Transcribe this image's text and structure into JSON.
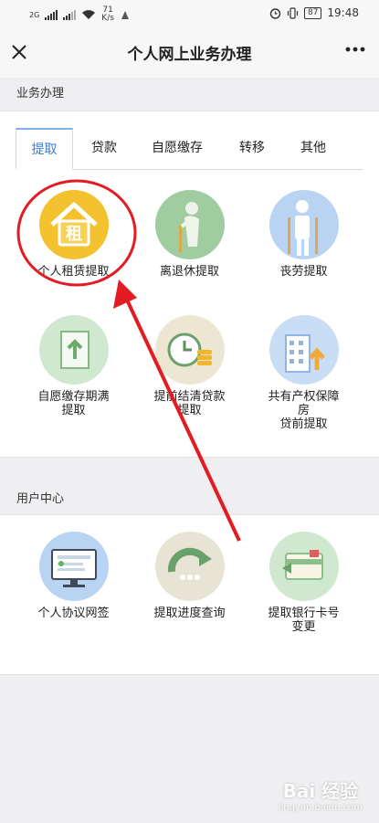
{
  "status_bar": {
    "network": "2G",
    "net_speed_value": "71",
    "net_speed_unit": "K/s",
    "battery": "87",
    "time": "19:48"
  },
  "nav": {
    "title": "个人网上业务办理",
    "close_icon": "close-icon",
    "more_icon": "more-icon"
  },
  "business": {
    "section_title": "业务办理",
    "tabs": [
      {
        "label": "提取",
        "active": true
      },
      {
        "label": "贷款",
        "active": false
      },
      {
        "label": "自愿缴存",
        "active": false
      },
      {
        "label": "转移",
        "active": false
      },
      {
        "label": "其他",
        "active": false
      }
    ],
    "items": [
      {
        "label": "个人租赁提取",
        "icon": "rent-house-icon",
        "badge_text": "租",
        "color": "#f3c22e"
      },
      {
        "label": "离退休提取",
        "icon": "elderly-person-icon",
        "color": "#9fcd9f"
      },
      {
        "label": "丧劳提取",
        "icon": "crutch-person-icon",
        "color": "#b9d3f2"
      },
      {
        "label": "自愿缴存期满\n提取",
        "icon": "document-upload-icon",
        "color": "#cfe8cf"
      },
      {
        "label": "提前结清贷款\n提取",
        "icon": "clock-coins-icon",
        "color": "#ece6d2"
      },
      {
        "label": "共有产权保障\n房\n贷前提取",
        "icon": "building-icon",
        "color": "#c9def4"
      }
    ]
  },
  "user_center": {
    "section_title": "用户中心",
    "items": [
      {
        "label": "个人协议网签",
        "icon": "monitor-contract-icon",
        "color": "#b9d3f2"
      },
      {
        "label": "提取进度查询",
        "icon": "progress-arrow-icon",
        "color": "#e7e4d6"
      },
      {
        "label": "提取银行卡号\n变更",
        "icon": "bank-card-icon",
        "color": "#cfe8cf"
      }
    ]
  },
  "watermark": {
    "text": "Bai 经验",
    "sub": "jingyan.baidu.com"
  }
}
